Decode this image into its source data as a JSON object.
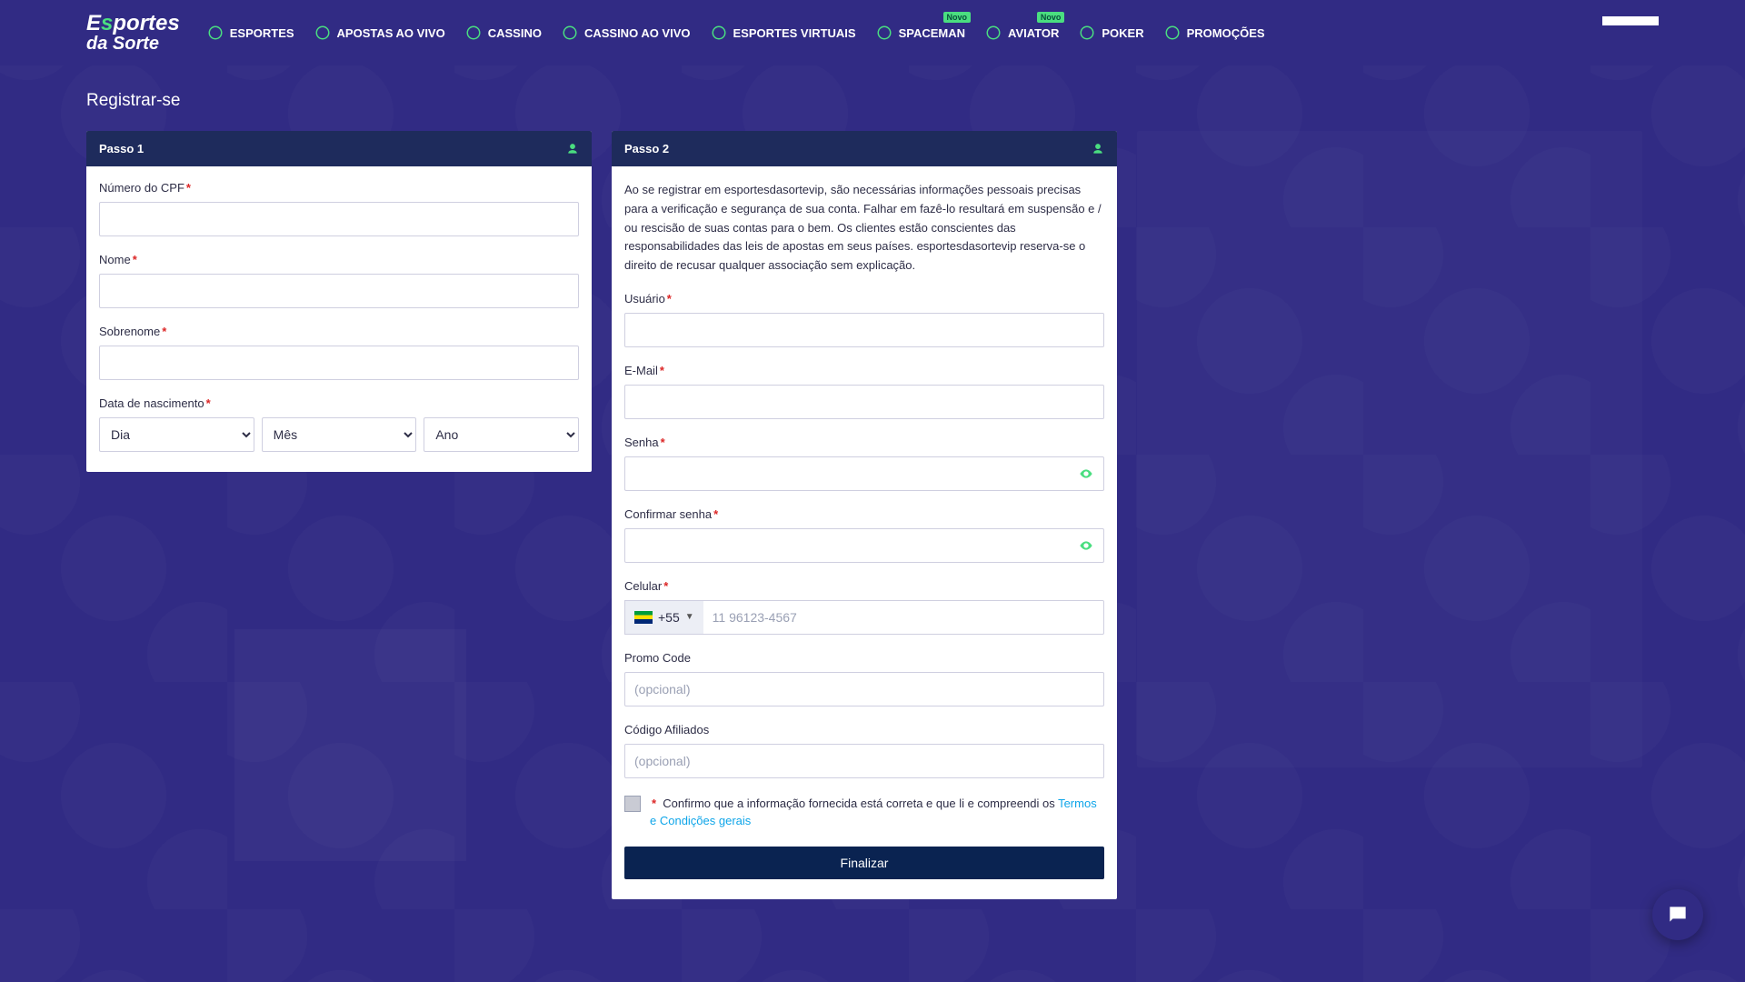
{
  "brand": {
    "line1_pre": "E",
    "line1_accent": "s",
    "line1_post": "portes",
    "line2": "da Sorte"
  },
  "nav": [
    {
      "label": "ESPORTES",
      "icon": "sports-icon",
      "badge": null
    },
    {
      "label": "APOSTAS AO VIVO",
      "icon": "live-bets-icon",
      "badge": null
    },
    {
      "label": "CASSINO",
      "icon": "casino-icon",
      "badge": null
    },
    {
      "label": "CASSINO AO VIVO",
      "icon": "live-casino-icon",
      "badge": null
    },
    {
      "label": "ESPORTES VIRTUAIS",
      "icon": "virtual-sports-icon",
      "badge": null
    },
    {
      "label": "SPACEMAN",
      "icon": "spaceman-icon",
      "badge": "Novo"
    },
    {
      "label": "AVIATOR",
      "icon": "aviator-icon",
      "badge": "Novo"
    },
    {
      "label": "POKER",
      "icon": "poker-icon",
      "badge": null
    },
    {
      "label": "PROMOÇÕES",
      "icon": "promotions-icon",
      "badge": null
    }
  ],
  "page": {
    "title": "Registrar-se"
  },
  "step1": {
    "title": "Passo 1",
    "fields": {
      "cpf": "Número do CPF",
      "nome": "Nome",
      "sobrenome": "Sobrenome",
      "dob": "Data de nascimento",
      "day": "Dia",
      "month": "Mês",
      "year": "Ano"
    }
  },
  "step2": {
    "title": "Passo 2",
    "intro": "Ao se registrar em esportesdasortevip, são necessárias informações pessoais precisas para a verificação e segurança de sua conta. Falhar em fazê-lo resultará em suspensão e / ou rescisão de suas contas para o bem. Os clientes estão conscientes das responsabilidades das leis de apostas em seus países. esportesdasortevip reserva-se o direito de recusar qualquer associação sem explicação.",
    "fields": {
      "usuario": "Usuário",
      "email": "E-Mail",
      "senha": "Senha",
      "conf_senha": "Confirmar senha",
      "celular": "Celular",
      "promo": "Promo Code",
      "afiliados": "Código Afiliados"
    },
    "phone": {
      "prefix": "+55",
      "placeholder": "11 96123-4567"
    },
    "optional_placeholder": "(opcional)",
    "confirm_text": "Confirmo que a informação fornecida está correta e que li e compreendi os ",
    "terms_link": "Termos e Condições gerais",
    "submit": "Finalizar"
  }
}
